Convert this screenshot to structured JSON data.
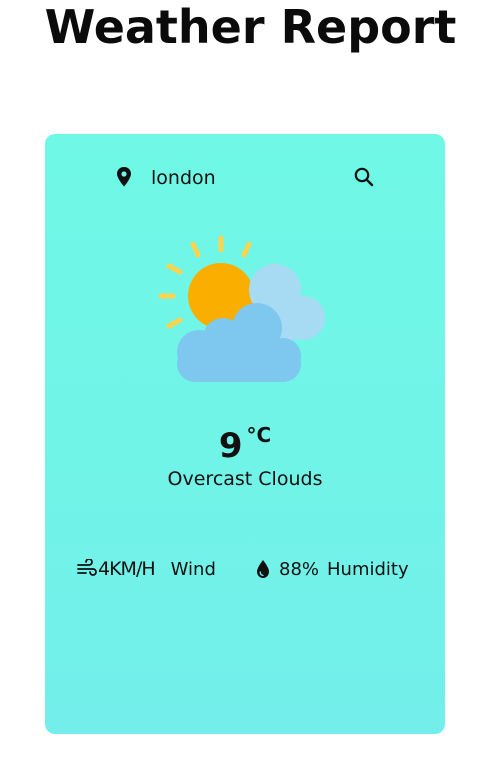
{
  "header": {
    "title": "Weather Report"
  },
  "search": {
    "city_value": "london",
    "pin_icon": "location-pin-icon",
    "search_icon": "search-icon"
  },
  "current": {
    "icon": "partly-cloudy-sun-icon",
    "temperature": "9",
    "unit": "°C",
    "description": "Overcast Clouds"
  },
  "details": {
    "wind_icon": "wind-icon",
    "wind_speed": "4KM/H",
    "wind_label": "Wind",
    "humidity_icon": "droplet-icon",
    "humidity_value": "88%",
    "humidity_label": "Humidity"
  },
  "colors": {
    "card_background": "#70f5e8",
    "sun": "#f9ae00",
    "sun_rays": "#fcd34d",
    "cloud_front": "#7ec8f0",
    "cloud_back": "#a7dbf4"
  }
}
